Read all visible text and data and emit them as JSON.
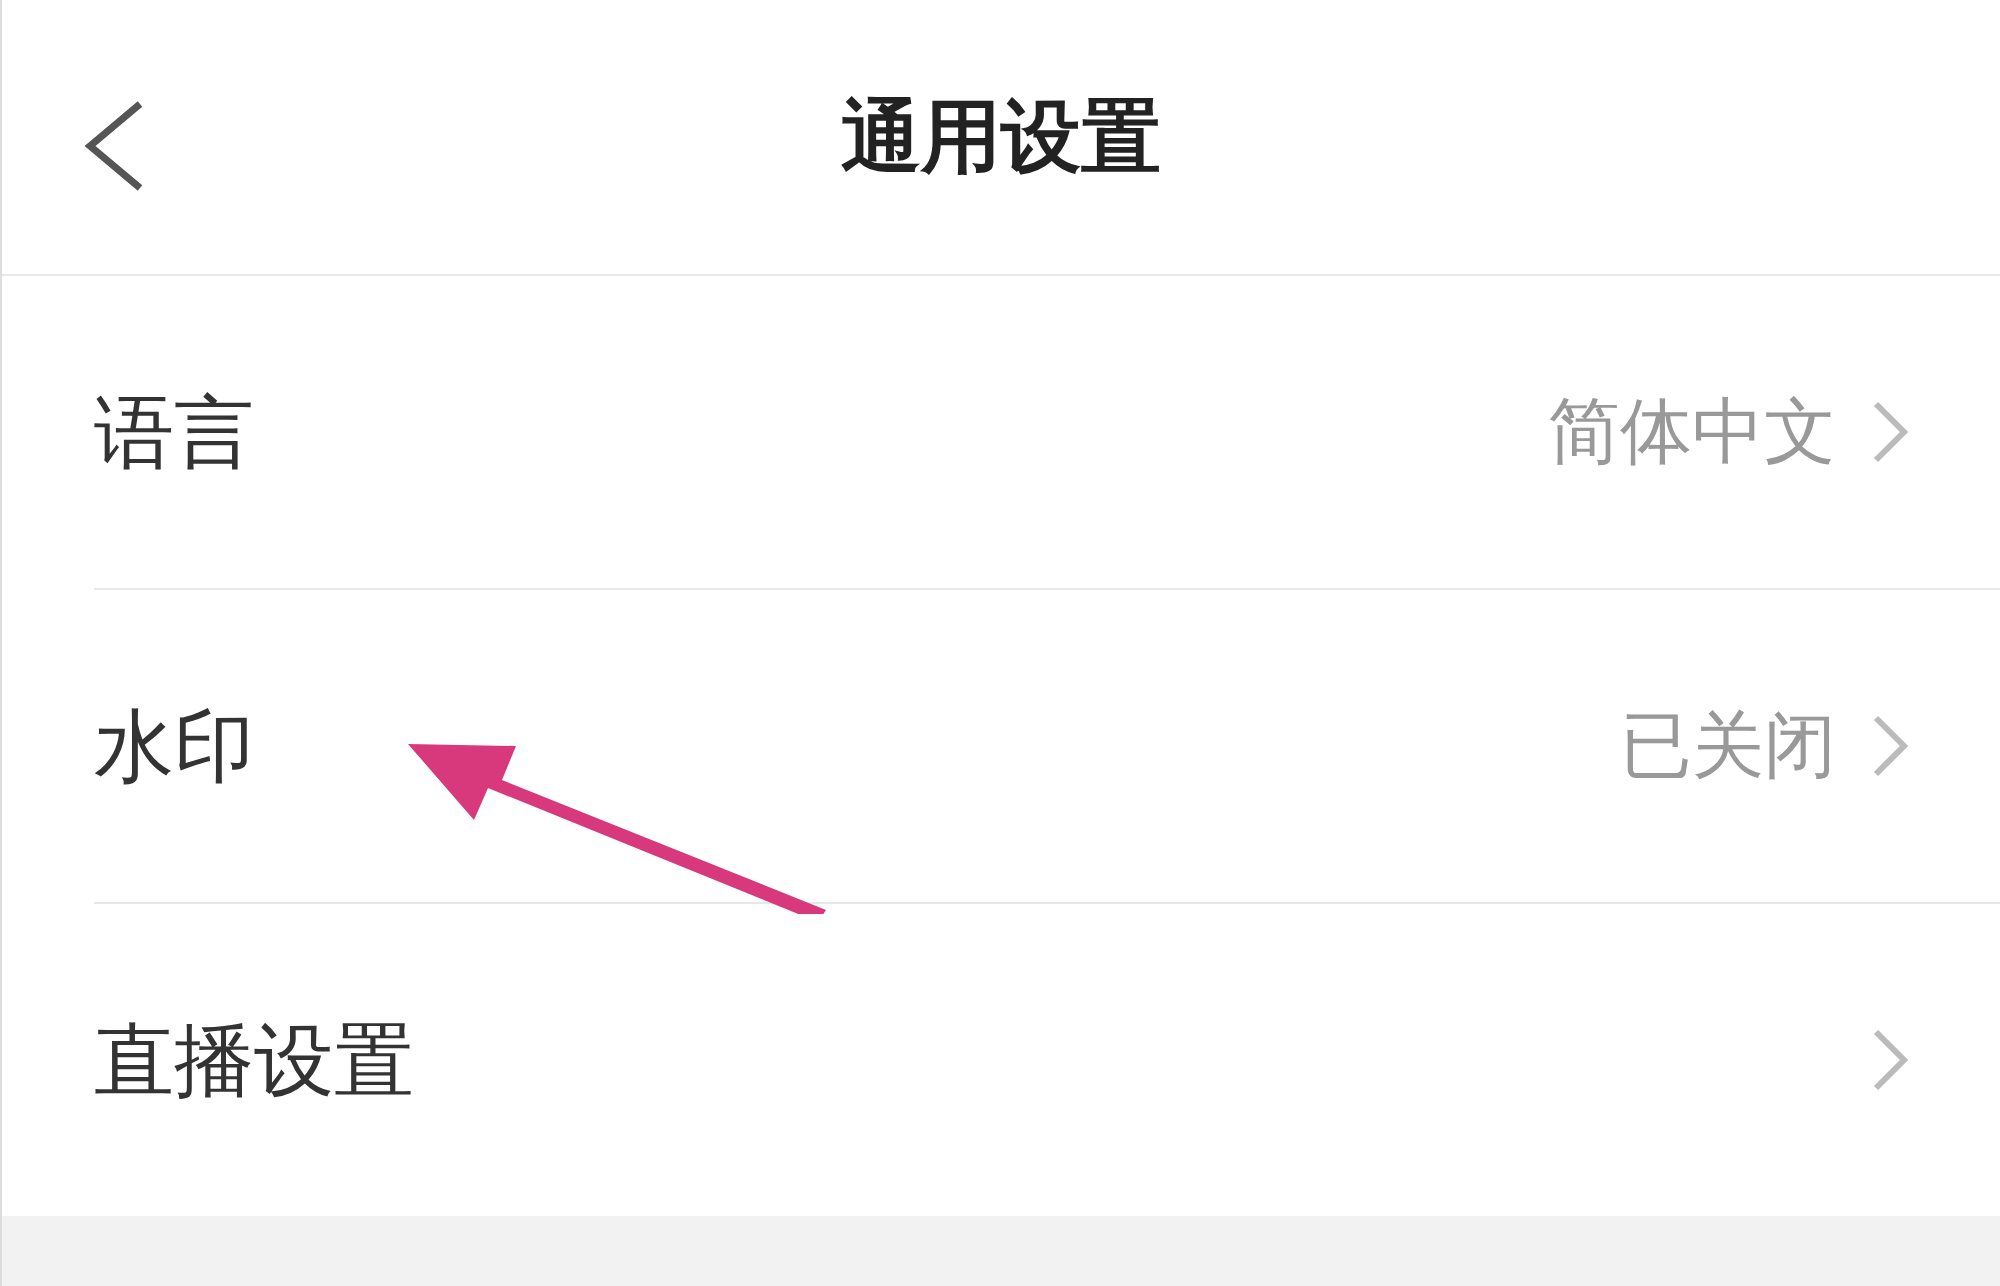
{
  "header": {
    "title": "通用设置"
  },
  "rows": [
    {
      "label": "语言",
      "value": "简体中文"
    },
    {
      "label": "水印",
      "value": "已关闭"
    },
    {
      "label": "直播设置"
    }
  ]
}
